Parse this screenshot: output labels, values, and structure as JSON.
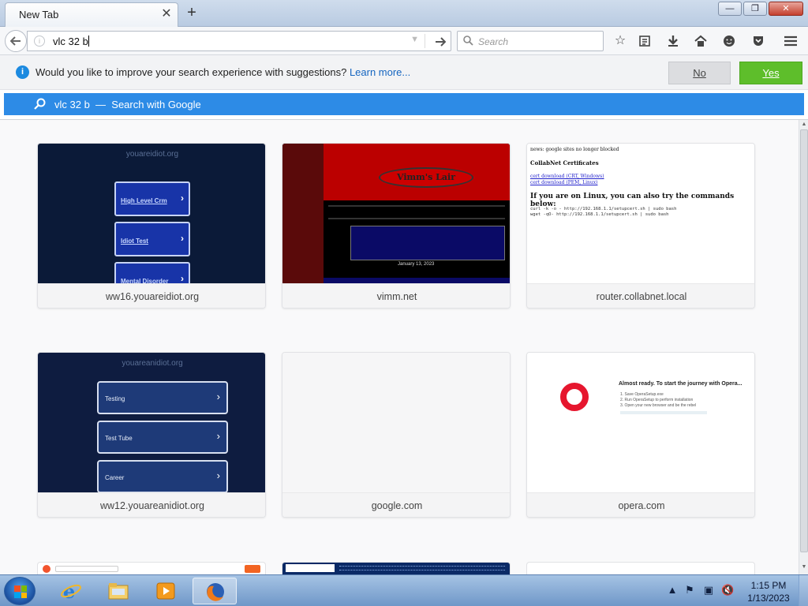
{
  "tab": {
    "title": "New Tab",
    "close": "✕",
    "new_tab": "+"
  },
  "window_controls": {
    "minimize": "—",
    "maximize": "❐",
    "close": "✕"
  },
  "navbar": {
    "url_value": "vlc 32 b",
    "search_placeholder": "Search"
  },
  "notification": {
    "message": "Would you like to improve your search experience with suggestions?",
    "link": "Learn more...",
    "no_label": "No",
    "yes_label": "Yes"
  },
  "suggestion": {
    "query": "vlc 32 b",
    "separator": "—",
    "action": "Search with Google"
  },
  "tiles": [
    {
      "caption": "ww16.youareidiot.org",
      "thumb_title": "youareidiot.org",
      "buttons": [
        "High Level Crm",
        "Idiot Test",
        "Mental Disorder"
      ]
    },
    {
      "caption": "vimm.net",
      "thumb_title": "Vimm's Lair",
      "thumb_date": "January 13, 2023"
    },
    {
      "caption": "router.collabnet.local",
      "thumb_lines": [
        "news: google sites no longer blocked",
        "CollabNet Certificates",
        "cert download (CRT, Windows)",
        "cert download (PEM, Linux)",
        "If you are on Linux, you can also try the commands below:",
        "curl -k -o - http://192.168.1.1/setupcert.sh | sudo bash",
        "wget -qO- http://192.168.1.1/setupcert.sh | sudo bash"
      ]
    },
    {
      "caption": "ww12.youareanidiot.org",
      "thumb_title": "youareanidiot.org",
      "buttons": [
        "Testing",
        "Test Tube",
        "Career"
      ]
    },
    {
      "caption": "google.com"
    },
    {
      "caption": "opera.com",
      "thumb_title": "Almost ready. To start the journey with Opera...",
      "thumb_lines": [
        "1. Save OperaSetup.exe",
        "2. Run OperaSetup to perform installation",
        "3. Open your new browser and be the rebel"
      ]
    }
  ],
  "taskbar": {
    "clock_time": "1:15 PM",
    "clock_date": "1/13/2023"
  },
  "colors": {
    "accent_blue": "#2d8be6",
    "yes_green": "#5ebe2b",
    "info_blue": "#1c8ae0"
  }
}
